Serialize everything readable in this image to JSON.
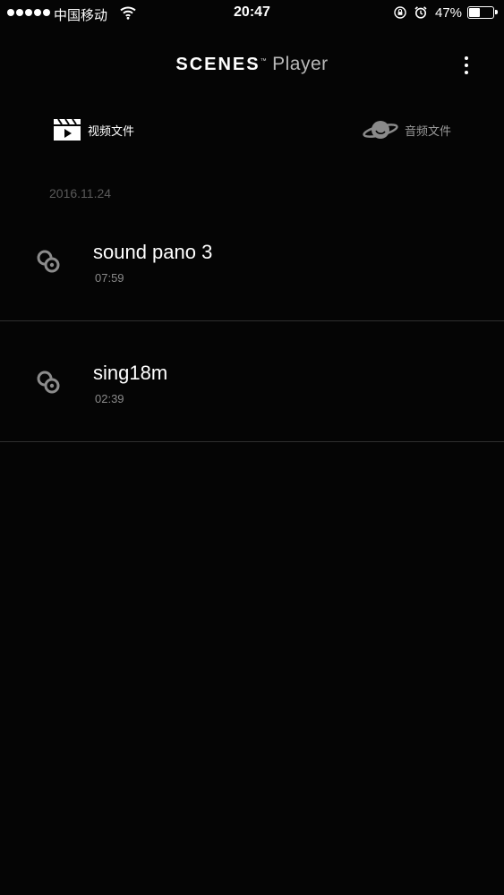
{
  "status_bar": {
    "carrier": "中国移动",
    "time": "20:47",
    "battery_percent": "47%",
    "battery_level": 0.47,
    "icons": [
      "signal-dots-icon",
      "wifi-icon",
      "rotation-lock-icon",
      "alarm-icon",
      "battery-icon"
    ]
  },
  "header": {
    "brand": "SCENES",
    "trademark": "™",
    "subtitle": "Player",
    "more_icon": "more-vertical-icon"
  },
  "tabs": [
    {
      "label": "视频文件",
      "icon": "clapperboard-icon",
      "active": true
    },
    {
      "label": "音频文件",
      "icon": "planet-icon",
      "active": false
    }
  ],
  "groups": [
    {
      "date": "2016.11.24",
      "items": [
        {
          "title": "sound pano 3",
          "duration": "07:59",
          "icon": "audio-file-icon"
        },
        {
          "title": "sing18m",
          "duration": "02:39",
          "icon": "audio-file-icon"
        }
      ]
    }
  ],
  "colors": {
    "background": "#050505",
    "divider": "#2e2e2e",
    "muted_text": "#8a8a8a",
    "date_text": "#5a5a5a"
  }
}
